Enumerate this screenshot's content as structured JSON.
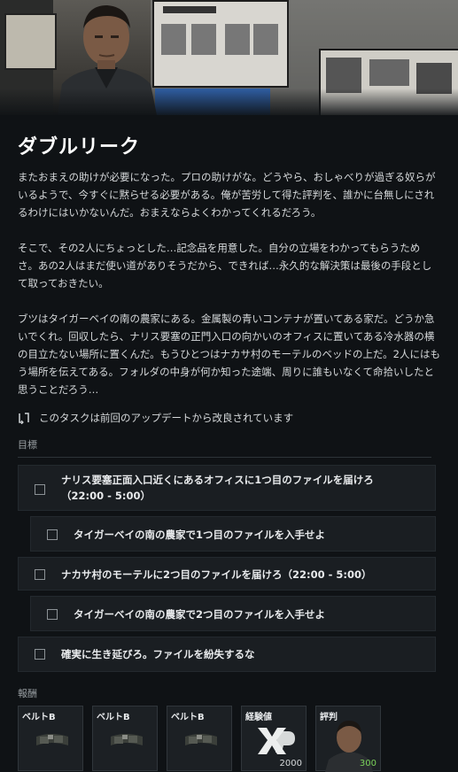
{
  "mission": {
    "title": "ダブルリーク",
    "paragraphs": [
      "またおまえの助けが必要になった。プロの助けがな。どうやら、おしゃべりが過ぎる奴らがいるようで、今すぐに黙らせる必要がある。俺が苦労して得た評判を、誰かに台無しにされるわけにはいかないんだ。おまえならよくわかってくれるだろう。",
      "そこで、その2人にちょっとした…記念品を用意した。自分の立場をわかってもらうためさ。あの2人はまだ使い道がありそうだから、できれば…永久的な解決策は最後の手段として取っておきたい。",
      "ブツはタイガーベイの南の農家にある。金属製の青いコンテナが置いてある家だ。どうか急いでくれ。回収したら、ナリス要塞の正門入口の向かいのオフィスに置いてある冷水器の横の目立たない場所に置くんだ。もうひとつはナカサ村のモーテルのベッドの上だ。2人にはもう場所を伝えてある。フォルダの中身が何か知った途端、周りに誰もいなくて命拾いしたと思うことだろう…"
    ],
    "update_note": "このタスクは前回のアップデートから改良されています"
  },
  "objectives": {
    "label": "目標",
    "items": [
      {
        "text": "ナリス要塞正面入口近くにあるオフィスに1つ目のファイルを届けろ（22:00 - 5:00）",
        "indent": false
      },
      {
        "text": "タイガーベイの南の農家で1つ目のファイルを入手せよ",
        "indent": true
      },
      {
        "text": "ナカサ村のモーテルに2つ目のファイルを届けろ（22:00 - 5:00）",
        "indent": false
      },
      {
        "text": "タイガーベイの南の農家で2つ目のファイルを入手せよ",
        "indent": true
      },
      {
        "text": "確実に生き延びろ。ファイルを紛失するな",
        "indent": false
      }
    ]
  },
  "rewards": {
    "label": "報酬",
    "items": [
      {
        "label": "ベルトB",
        "value": "",
        "icon": "belt-icon"
      },
      {
        "label": "ベルトB",
        "value": "",
        "icon": "belt-icon"
      },
      {
        "label": "ベルトB",
        "value": "",
        "icon": "belt-icon"
      },
      {
        "label": "経験値",
        "value": "2000",
        "icon": "xp-icon"
      },
      {
        "label": "評判",
        "value": "300",
        "icon": "reputation-portrait"
      }
    ]
  },
  "colors": {
    "accent_green": "#7bd35a",
    "background": "#0f1215"
  }
}
